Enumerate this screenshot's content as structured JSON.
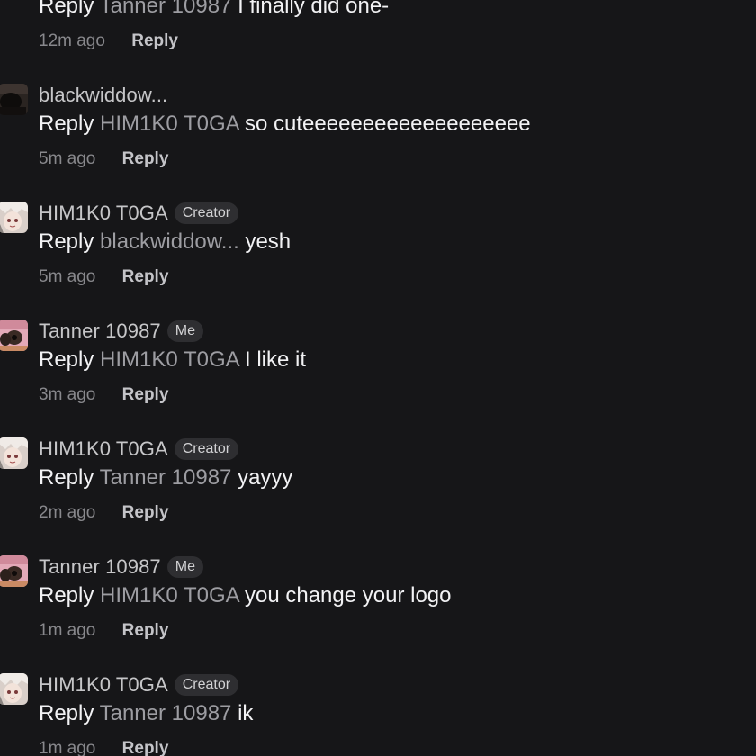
{
  "comments": [
    {
      "username": "",
      "badge": "",
      "reply_prefix": "Reply",
      "mention": "Tanner 10987",
      "text": "I finally did one-",
      "time": "12m ago",
      "reply_action": "Reply",
      "avatar": "none"
    },
    {
      "username": "blackwiddow...",
      "badge": "",
      "reply_prefix": "Reply",
      "mention": "HIM1K0 T0GA",
      "text": "so cuteeeeeeeeeeeeeeeeeee",
      "time": "5m ago",
      "reply_action": "Reply",
      "avatar": "dark"
    },
    {
      "username": "HIM1K0 T0GA",
      "badge": "Creator",
      "reply_prefix": "Reply",
      "mention": "blackwiddow...",
      "text": "yesh",
      "time": "5m ago",
      "reply_action": "Reply",
      "avatar": "anime"
    },
    {
      "username": "Tanner 10987",
      "badge": "Me",
      "reply_prefix": "Reply",
      "mention": "HIM1K0 T0GA",
      "text": "I like it",
      "time": "3m ago",
      "reply_action": "Reply",
      "avatar": "pink"
    },
    {
      "username": "HIM1K0 T0GA",
      "badge": "Creator",
      "reply_prefix": "Reply",
      "mention": "Tanner 10987",
      "text": "yayyy",
      "time": "2m ago",
      "reply_action": "Reply",
      "avatar": "anime"
    },
    {
      "username": "Tanner 10987",
      "badge": "Me",
      "reply_prefix": "Reply",
      "mention": "HIM1K0 T0GA",
      "text": "you change your logo",
      "time": "1m ago",
      "reply_action": "Reply",
      "avatar": "pink"
    },
    {
      "username": "HIM1K0 T0GA",
      "badge": "Creator",
      "reply_prefix": "Reply",
      "mention": "Tanner 10987",
      "text": "ik",
      "time": "1m ago",
      "reply_action": "Reply",
      "avatar": "anime"
    }
  ]
}
